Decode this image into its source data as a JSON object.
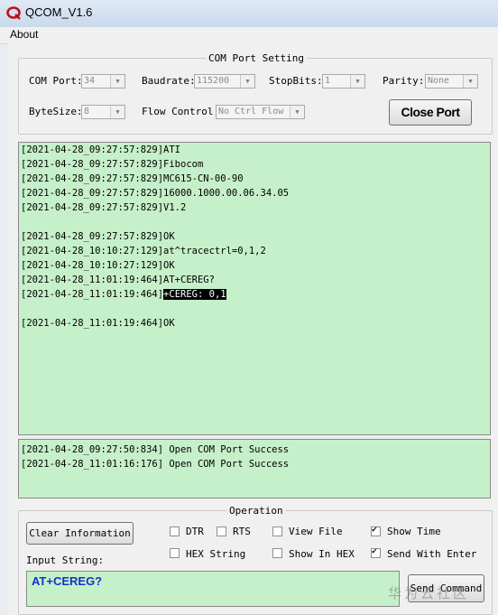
{
  "window": {
    "title": "QCOM_V1.6"
  },
  "menu": {
    "about": "About"
  },
  "com_port_setting": {
    "legend": "COM Port Setting",
    "com_port_label": "COM Port:",
    "com_port_value": "34",
    "baudrate_label": "Baudrate:",
    "baudrate_value": "115200",
    "stopbits_label": "StopBits:",
    "stopbits_value": "1",
    "parity_label": "Parity:",
    "parity_value": "None",
    "bytesize_label": "ByteSize:",
    "bytesize_value": "8",
    "flow_control_label": "Flow Control:",
    "flow_control_value": "No Ctrl Flow",
    "close_port_label": "Close Port"
  },
  "log": {
    "lines": [
      "[2021-04-28_09:27:57:829]ATI",
      "[2021-04-28_09:27:57:829]Fibocom",
      "[2021-04-28_09:27:57:829]MC615-CN-00-90",
      "[2021-04-28_09:27:57:829]16000.1000.00.06.34.05",
      "[2021-04-28_09:27:57:829]V1.2",
      "",
      "[2021-04-28_09:27:57:829]OK",
      "[2021-04-28_10:10:27:129]at^tracectrl=0,1,2",
      "[2021-04-28_10:10:27:129]OK",
      "[2021-04-28_11:01:19:464]AT+CEREG?",
      "[2021-04-28_11:01:19:464]",
      "",
      "[2021-04-28_11:01:19:464]OK"
    ],
    "selected_text": "+CEREG: 0,1"
  },
  "status": {
    "lines": [
      "[2021-04-28_09:27:50:834] Open COM Port Success",
      "[2021-04-28_11:01:16:176] Open COM Port Success"
    ]
  },
  "operation": {
    "legend": "Operation",
    "clear_information_label": "Clear Information",
    "dtr_label": "DTR",
    "dtr_checked": false,
    "rts_label": "RTS",
    "rts_checked": false,
    "view_file_label": "View File",
    "view_file_checked": false,
    "show_time_label": "Show Time",
    "show_time_checked": true,
    "hex_string_label": "HEX String",
    "hex_string_checked": false,
    "show_in_hex_label": "Show In HEX",
    "show_in_hex_checked": false,
    "send_with_enter_label": "Send With Enter",
    "send_with_enter_checked": true,
    "input_string_label": "Input String:",
    "input_string_value": "AT+CEREG?",
    "send_command_label": "Send Command"
  },
  "watermark": "华为云社区",
  "colors": {
    "log_background": "#c6f0c9",
    "input_text": "#1433c8"
  }
}
